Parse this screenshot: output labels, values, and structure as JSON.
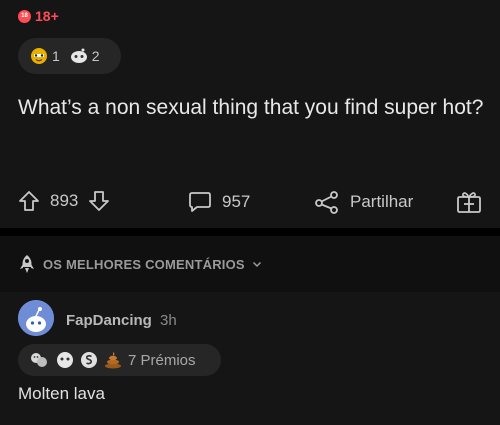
{
  "post": {
    "nsfw_icon_text": "18",
    "nsfw_label": "18+",
    "awards": [
      {
        "icon": "gold-face-award-icon",
        "count": "1"
      },
      {
        "icon": "snoo-award-icon",
        "count": "2"
      }
    ],
    "title": "What’s a non sexual thing that you find super hot?",
    "upvotes": "893",
    "comments": "957",
    "share_label": "Partilhar"
  },
  "sort": {
    "label": "OS MELHORES COMENTÁRIOS"
  },
  "comment": {
    "author": "FapDancing",
    "age": "3h",
    "awards_label": "7 Prémios",
    "award_icons": [
      "wholesome-hug-award-icon",
      "snoo-face-award-icon",
      "coin-award-icon",
      "poop-award-icon"
    ],
    "body": "Molten lava"
  },
  "colors": {
    "nsfw": "#ff4c55",
    "background": "#151515",
    "avatar": "#6f8cd6"
  }
}
